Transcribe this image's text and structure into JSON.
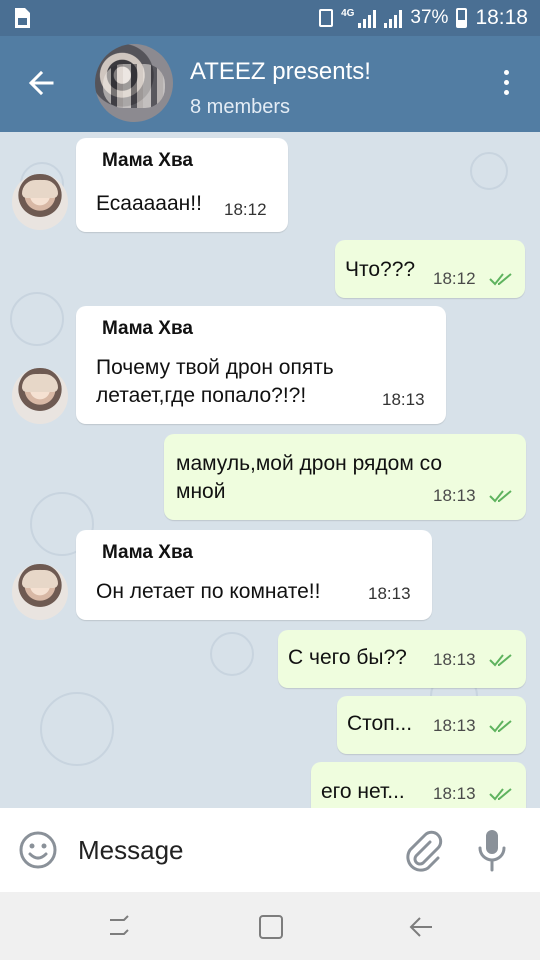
{
  "status_bar": {
    "network": "4G",
    "battery": "37%",
    "time": "18:18"
  },
  "header": {
    "title": "ATEEZ presents!",
    "subtitle": "8 members"
  },
  "messages": [
    {
      "sender": "Мама Хва",
      "text": "Есааааан!!",
      "time": "18:12"
    },
    {
      "text": "Что???",
      "time": "18:12"
    },
    {
      "sender": "Мама Хва",
      "text": "Почему твой дрон опять\nлетает,где попало?!?!",
      "time": "18:13"
    },
    {
      "text": "мамуль,мой дрон рядом со\nмной",
      "time": "18:13"
    },
    {
      "sender": "Мама Хва",
      "text": "Он летает по комнате!!",
      "time": "18:13"
    },
    {
      "text": "С чего бы??",
      "time": "18:13"
    },
    {
      "text": "Стоп...",
      "time": "18:13"
    },
    {
      "text": "его нет...",
      "time": "18:13"
    }
  ],
  "input": {
    "placeholder": "Message"
  },
  "colors": {
    "header": "#527da3",
    "status_bar": "#4a6f93",
    "outgoing_bubble": "#effdde",
    "incoming_bubble": "#ffffff",
    "read_ticks": "#5fb35f",
    "chat_background": "#d7e1e9"
  }
}
